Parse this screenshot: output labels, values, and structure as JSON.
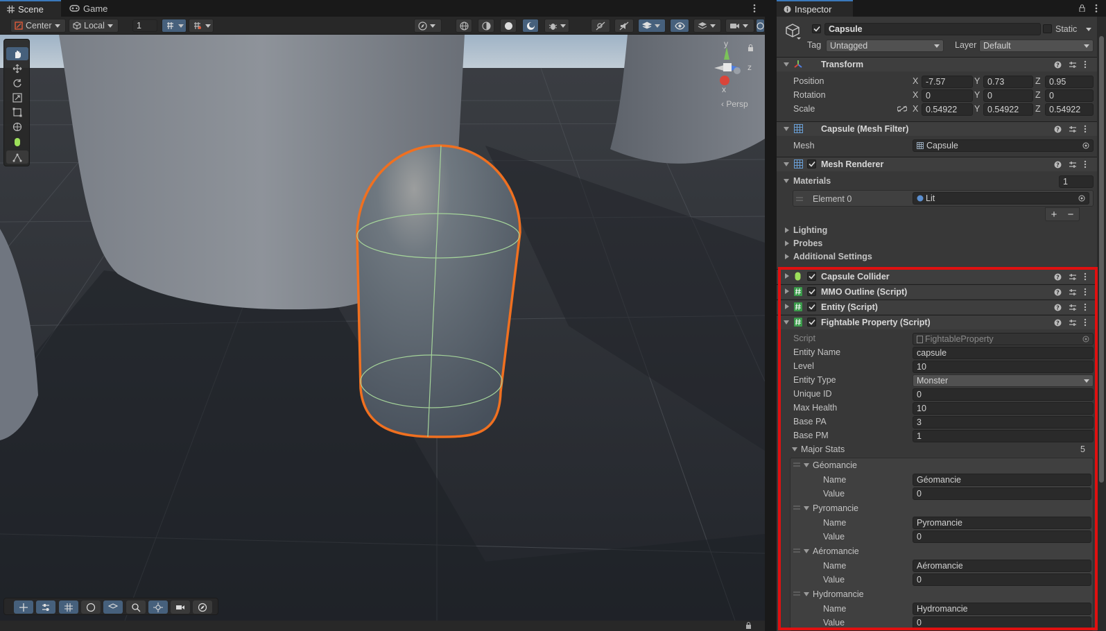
{
  "scene_tabs": [
    {
      "label": "Scene",
      "active": true,
      "icon": "grid-icon"
    },
    {
      "label": "Game",
      "active": false,
      "icon": "gamepad-icon"
    }
  ],
  "scene_toolbar": {
    "pivot_label": "Center",
    "space_label": "Local",
    "grid_snap_value": "1"
  },
  "scene_view": {
    "projection_label": "Persp",
    "gizmo_axes": {
      "x": "x",
      "y": "y",
      "z": "z"
    },
    "selected_object_outline": "#f07020"
  },
  "inspector": {
    "tab_label": "Inspector",
    "object": {
      "name": "Capsule",
      "active": true,
      "static_label": "Static",
      "tag_label": "Tag",
      "tag_value": "Untagged",
      "layer_label": "Layer",
      "layer_value": "Default"
    },
    "transform": {
      "title": "Transform",
      "position_label": "Position",
      "rotation_label": "Rotation",
      "scale_label": "Scale",
      "position": {
        "x": "-7.57",
        "y": "0.73",
        "z": "0.95"
      },
      "rotation": {
        "x": "0",
        "y": "0",
        "z": "0"
      },
      "scale": {
        "x": "0.54922",
        "y": "0.54922",
        "z": "0.54922"
      },
      "axis_x": "X",
      "axis_y": "Y",
      "axis_z": "Z"
    },
    "mesh_filter": {
      "title": "Capsule (Mesh Filter)",
      "mesh_label": "Mesh",
      "mesh_value": "Capsule"
    },
    "mesh_renderer": {
      "title": "Mesh Renderer",
      "materials_label": "Materials",
      "materials_count": "1",
      "element_label": "Element 0",
      "element_value": "Lit",
      "plus": "+",
      "minus": "−",
      "lighting_label": "Lighting",
      "probes_label": "Probes",
      "additional_label": "Additional Settings"
    },
    "components": [
      {
        "title": "Capsule Collider"
      },
      {
        "title": "MMO Outline (Script)"
      },
      {
        "title": "Entity (Script)"
      },
      {
        "title": "Fightable Property (Script)"
      }
    ],
    "fightable": {
      "script_label": "Script",
      "script_value": "FightableProperty",
      "entity_name_label": "Entity Name",
      "entity_name": "capsule",
      "level_label": "Level",
      "level": "10",
      "entity_type_label": "Entity Type",
      "entity_type": "Monster",
      "unique_id_label": "Unique ID",
      "unique_id": "0",
      "max_health_label": "Max Health",
      "max_health": "10",
      "base_pa_label": "Base PA",
      "base_pa": "3",
      "base_pm_label": "Base PM",
      "base_pm": "1",
      "major_stats_label": "Major Stats",
      "major_stats_count": "5",
      "name_label": "Name",
      "value_label": "Value",
      "stats": [
        {
          "header": "Géomancie",
          "name": "Géomancie",
          "value": "0"
        },
        {
          "header": "Pyromancie",
          "name": "Pyromancie",
          "value": "0"
        },
        {
          "header": "Aéromancie",
          "name": "Aéromancie",
          "value": "0"
        },
        {
          "header": "Hydromancie",
          "name": "Hydromancie",
          "value": "0"
        }
      ]
    },
    "highlight_color": "#e01010"
  }
}
